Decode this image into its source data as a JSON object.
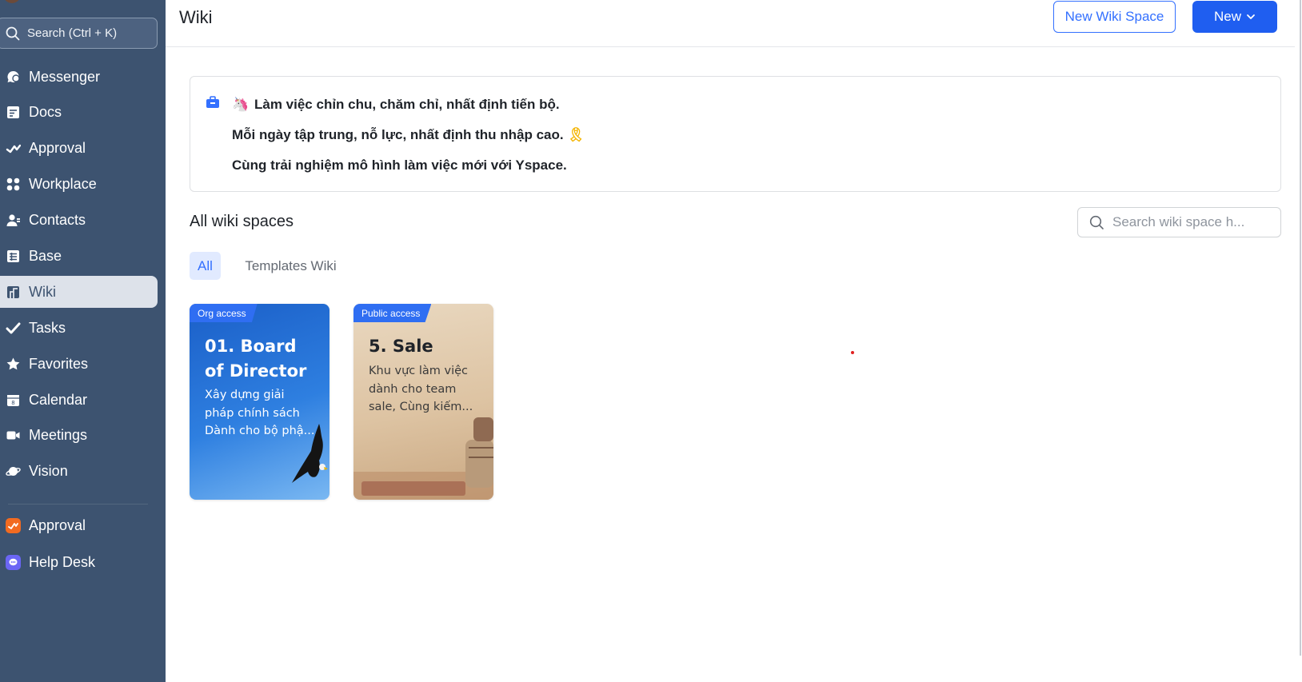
{
  "sidebar": {
    "search_label": "Search (Ctrl + K)",
    "items": [
      {
        "label": "Messenger",
        "icon": "messenger-icon"
      },
      {
        "label": "Docs",
        "icon": "docs-icon"
      },
      {
        "label": "Approval",
        "icon": "approval-icon"
      },
      {
        "label": "Workplace",
        "icon": "workplace-icon"
      },
      {
        "label": "Contacts",
        "icon": "contacts-icon"
      },
      {
        "label": "Base",
        "icon": "base-icon"
      },
      {
        "label": "Wiki",
        "icon": "wiki-icon",
        "active": true
      },
      {
        "label": "Tasks",
        "icon": "tasks-icon"
      },
      {
        "label": "Favorites",
        "icon": "star-icon"
      },
      {
        "label": "Calendar",
        "icon": "calendar-icon"
      },
      {
        "label": "Meetings",
        "icon": "video-icon"
      },
      {
        "label": "Vision",
        "icon": "planet-icon"
      }
    ],
    "apps": [
      {
        "label": "Approval",
        "icon": "approval-app-icon",
        "color": "#f26b21"
      },
      {
        "label": "Help Desk",
        "icon": "helpdesk-app-icon",
        "color": "#6b66f5"
      }
    ]
  },
  "header": {
    "title": "Wiki",
    "new_wiki_space_label": "New Wiki Space",
    "new_label": "New"
  },
  "announcement": {
    "line1": "Làm việc chỉn chu, chăm chỉ, nhất định tiến bộ.",
    "line2": "Mỗi ngày tập trung, nỗ lực, nhất định thu nhập cao.",
    "line3": "Cùng trải nghiệm mô hình làm việc mới với Yspace."
  },
  "spaces": {
    "section_title": "All wiki spaces",
    "search_placeholder": "Search wiki space h...",
    "tabs": [
      "All",
      "Templates Wiki"
    ],
    "cards": [
      {
        "badge": "Org access",
        "title": "01. Board of Director",
        "description": "Xây dựng giải pháp chính sách Dành cho bộ phậ..."
      },
      {
        "badge": "Public access",
        "title": "5. Sale",
        "description": "Khu vực làm việc dành cho team sale, Cùng kiếm..."
      }
    ]
  },
  "colors": {
    "sidebar_bg": "#3d5370",
    "primary": "#1f5ef0",
    "accent": "#3370ff"
  }
}
